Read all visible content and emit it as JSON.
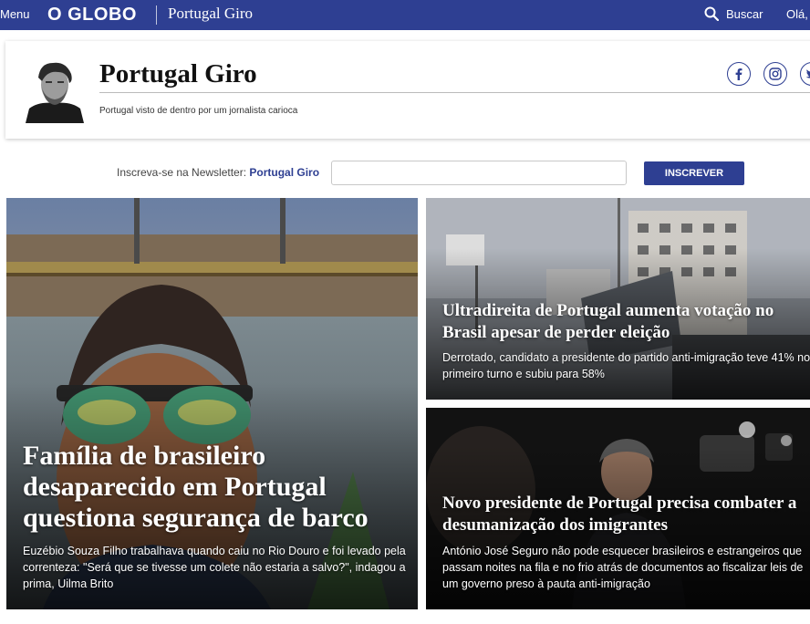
{
  "topbar": {
    "menu_label": "Menu",
    "logo": "O GLOBO",
    "blog_name": "Portugal Giro",
    "search_label": "Buscar",
    "user_label": "Olá, l"
  },
  "blog": {
    "title": "Portugal Giro",
    "description": "Portugal visto de dentro por um jornalista carioca",
    "social_icons": [
      "facebook-icon",
      "instagram-icon",
      "twitter-icon"
    ]
  },
  "newsletter": {
    "label": "Inscreva-se na Newsletter: ",
    "name": "Portugal Giro",
    "input_value": "",
    "button_label": "INSCREVER"
  },
  "articles": [
    {
      "headline": "Família de brasileiro desaparecido em Portugal questiona segurança de barco",
      "summary": "Euzébio Souza Filho trabalhava quando caiu no Rio Douro e foi levado pela correnteza: \"Será que se tivesse um colete não estaria a salvo?\", indagou a prima, Uilma Brito"
    },
    {
      "headline": "Ultradireita de Portugal aumenta votação no Brasil apesar de perder eleição",
      "summary": "Derrotado, candidato a presidente do partido anti-imigração teve 41% no primeiro turno e subiu para 58%"
    },
    {
      "headline": "Novo presidente de Portugal precisa combater a desumanização dos imigrantes",
      "summary": "António José Seguro não pode esquecer brasileiros e estrangeiros que passam noites na fila e no frio atrás de documentos ao fiscalizar leis de um governo preso à pauta anti-imigração"
    }
  ],
  "colors": {
    "brand": "#2e3f92",
    "white": "#ffffff"
  }
}
